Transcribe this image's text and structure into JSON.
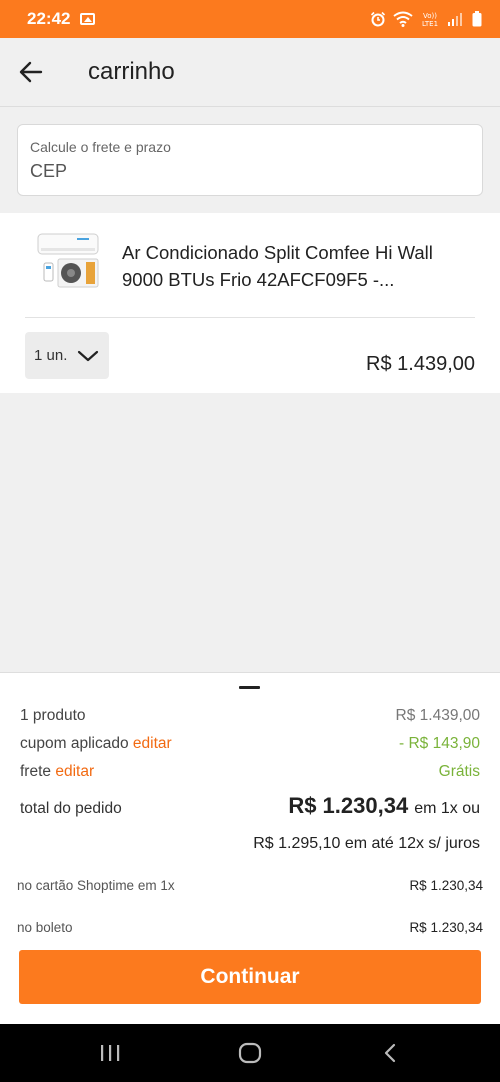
{
  "status_bar": {
    "time": "22:42",
    "icons": [
      "gallery-icon",
      "alarm-icon",
      "wifi-icon",
      "volte-icon",
      "signal-icon",
      "battery-icon"
    ],
    "color": "#fc7a1e"
  },
  "header": {
    "title": "carrinho",
    "back_icon": "arrow-left-icon"
  },
  "cep": {
    "label": "Calcule o frete e prazo",
    "placeholder": "CEP",
    "value": ""
  },
  "product": {
    "name": "Ar Condicionado Split Comfee Hi Wall 9000 BTUs Frio 42AFCF09F5 -...",
    "quantity": "1 un.",
    "price": "R$ 1.439,00"
  },
  "summary": {
    "products_label": "1 produto",
    "products_value": "R$ 1.439,00",
    "coupon_label": "cupom aplicado",
    "coupon_edit": "editar",
    "coupon_value": "- R$ 143,90",
    "shipping_label": "frete",
    "shipping_edit": "editar",
    "shipping_value": "Grátis",
    "total_label": "total do pedido",
    "total_value": "R$ 1.230,34",
    "total_suffix": "em 1x ou",
    "installments": "R$ 1.295,10 em até 12x s/ juros",
    "card_label": "no cartão Shoptime em 1x",
    "card_value": "R$ 1.230,34",
    "boleto_label": "no boleto",
    "boleto_value": "R$ 1.230,34"
  },
  "continue_label": "Continuar",
  "colors": {
    "accent": "#fc7a1e",
    "link": "#f26a12",
    "discount": "#7ab33a"
  },
  "nav_bar": {
    "icons": [
      "recent-apps-icon",
      "home-icon",
      "back-icon"
    ]
  }
}
